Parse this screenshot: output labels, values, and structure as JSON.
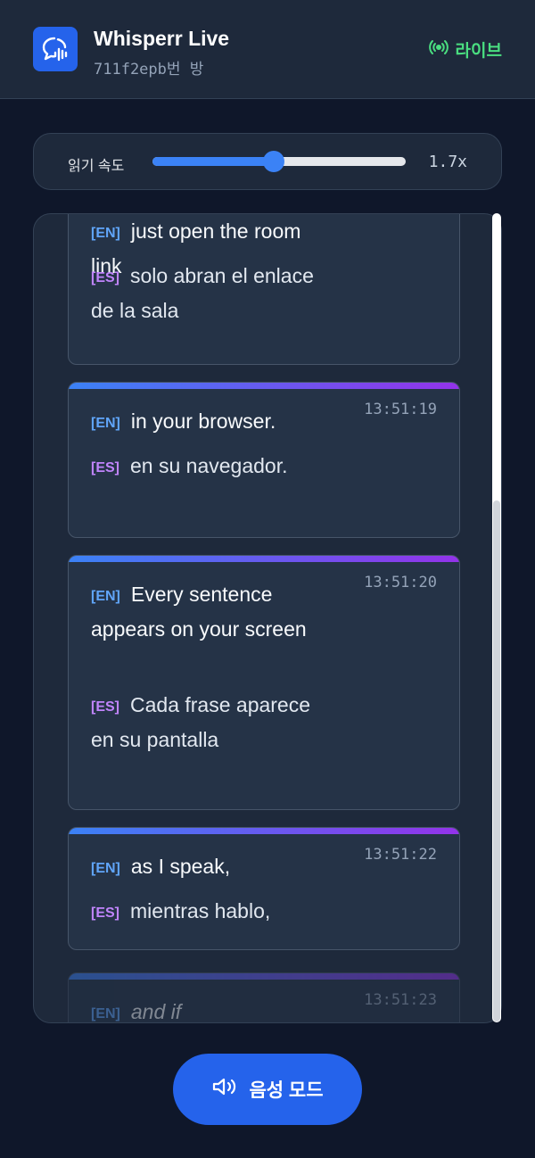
{
  "header": {
    "title": "Whisperr Live",
    "room": "711f2epb번 방",
    "live_label": "라이브"
  },
  "speed": {
    "label": "읽기 속도",
    "value_text": "1.7x",
    "fraction": 0.48
  },
  "messages": [
    {
      "en": "just open the room link",
      "es": "solo abran el enlace de la sala",
      "time": ""
    },
    {
      "en": "in your browser.",
      "es": "en su navegador.",
      "time": "13:51:19"
    },
    {
      "en": "Every sentence appears on your screen",
      "es": "Cada frase aparece en su pantalla",
      "time": "13:51:20"
    },
    {
      "en": "as I speak,",
      "es": "mientras hablo,",
      "time": "13:51:22"
    },
    {
      "en": "and if",
      "es": "",
      "time": "13:51:23"
    }
  ],
  "tags": {
    "en": "[EN]",
    "es": "[ES]"
  },
  "voice_button": {
    "label": "음성 모드"
  },
  "icons": {
    "logo": "chat-waveform-icon",
    "live": "broadcast-icon",
    "voice": "speaker-icon"
  },
  "colors": {
    "accent": "#2563eb",
    "live": "#4ade80",
    "en_tag": "#60a5fa",
    "es_tag": "#c084fc"
  }
}
